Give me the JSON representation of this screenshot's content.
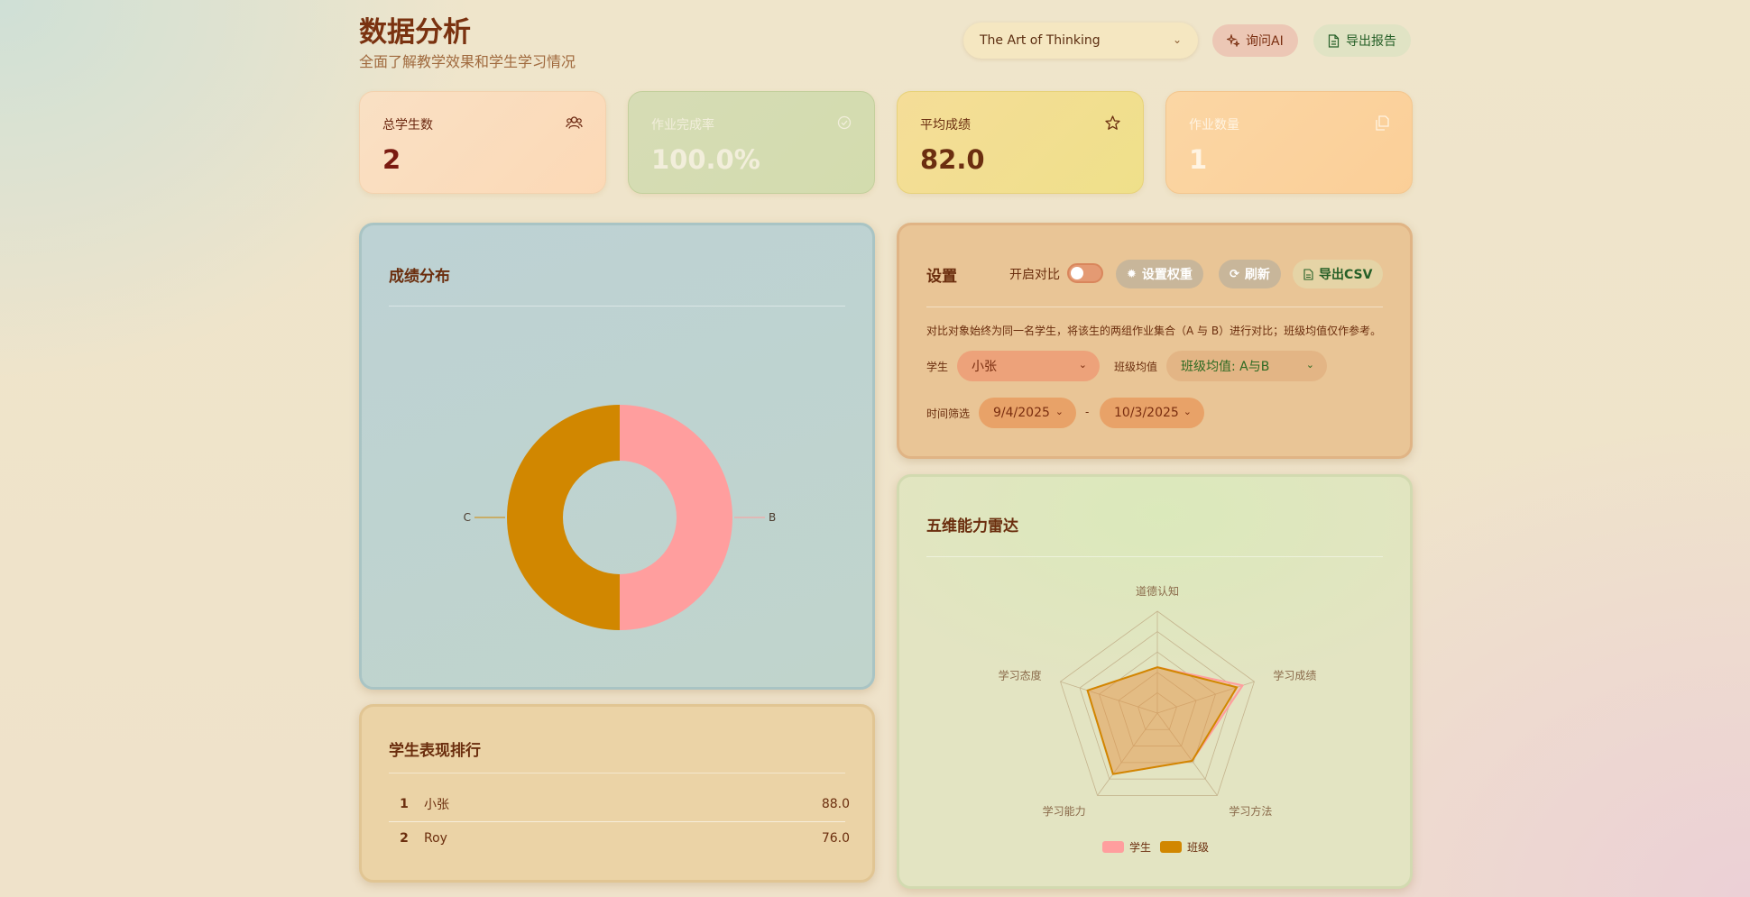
{
  "header": {
    "title": "数据分析",
    "subtitle": "全面了解教学效果和学生学习情况",
    "course_select": "The Art of Thinking",
    "ask_ai": "询问AI",
    "export_report": "导出报告"
  },
  "stats": [
    {
      "label": "总学生数",
      "value": "2",
      "icon": "users-icon"
    },
    {
      "label": "作业完成率",
      "value": "100.0%",
      "icon": "check-circle-icon"
    },
    {
      "label": "平均成绩",
      "value": "82.0",
      "icon": "star-icon"
    },
    {
      "label": "作业数量",
      "value": "1",
      "icon": "documents-icon"
    }
  ],
  "grade_distribution": {
    "title": "成绩分布",
    "chart_data": {
      "type": "pie",
      "categories": [
        "B",
        "C"
      ],
      "values": [
        1,
        1
      ],
      "colors": [
        "#ff9e9e",
        "#d18700"
      ]
    }
  },
  "ranking": {
    "title": "学生表现排行",
    "rows": [
      {
        "rank": "1",
        "name": "小张",
        "score": "88.0"
      },
      {
        "rank": "2",
        "name": "Roy",
        "score": "76.0"
      }
    ]
  },
  "settings": {
    "title": "设置",
    "compare_label": "开启对比",
    "set_weights": "设置权重",
    "refresh": "刷新",
    "export_csv": "导出CSV",
    "note": "对比对象始终为同一名学生，将该生的两组作业集合（A 与 B）进行对比；班级均值仅作参考。",
    "student_label": "学生",
    "student_value": "小张",
    "class_avg_label": "班级均值",
    "class_avg_value": "班级均值: A与B",
    "time_label": "时间筛选",
    "date_from": "9/4/2025",
    "date_sep": "-",
    "date_to": "10/3/2025"
  },
  "radar": {
    "title": "五维能力雷达",
    "chart_data": {
      "type": "radar",
      "axes": [
        "道德认知",
        "学习成绩",
        "学习方法",
        "学习能力",
        "学习态度"
      ],
      "max": 100,
      "series": [
        {
          "name": "学生",
          "values": [
            45,
            88,
            58,
            74,
            72
          ],
          "color": "#ff9e9e"
        },
        {
          "name": "班级",
          "values": [
            45,
            82,
            58,
            74,
            72
          ],
          "color": "#d18700"
        }
      ]
    }
  }
}
